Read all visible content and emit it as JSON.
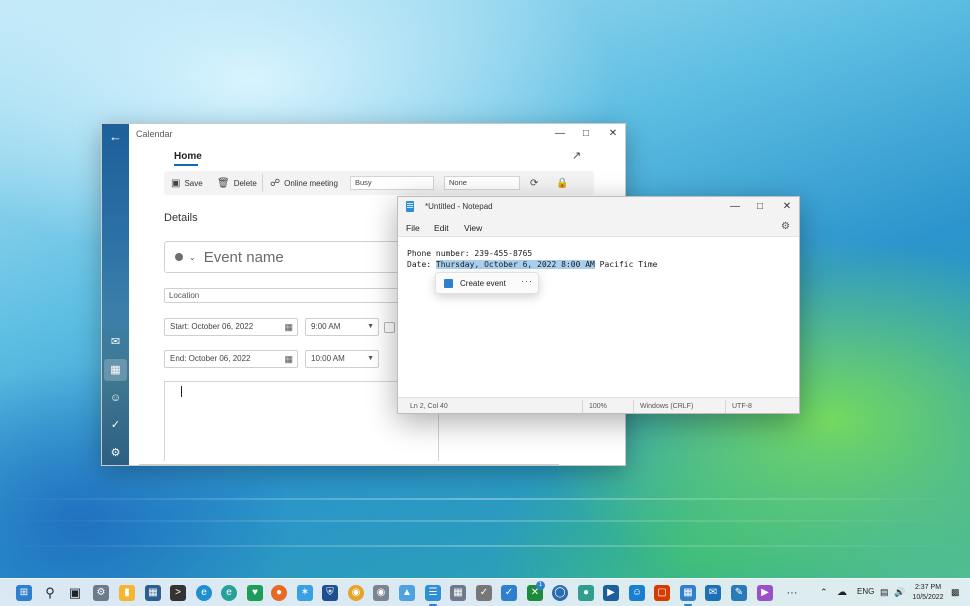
{
  "colors": {
    "accent": "#0f6cbd",
    "selection": "#a9cfee",
    "taskbar": "#e8f0f6"
  },
  "calendar": {
    "window_title": "Calendar",
    "tab_home": "Home",
    "toolbar": {
      "save": "Save",
      "delete": "Delete",
      "online_meeting": "Online meeting",
      "show_as": "Busy",
      "reminder": "None"
    },
    "details_heading": "Details",
    "event_name_placeholder": "Event name",
    "location_placeholder": "Location",
    "start_label": "Start: October 06, 2022",
    "start_time": "9:00 AM",
    "end_label": "End: October 06, 2022",
    "end_time": "10:00 AM",
    "nav_icons": [
      "back-arrow-icon",
      "mail-icon",
      "calendar-icon",
      "people-icon",
      "todo-icon",
      "settings-icon"
    ]
  },
  "notepad": {
    "window_title": "*Untitled - Notepad",
    "menu": [
      "File",
      "Edit",
      "View"
    ],
    "line1": "Phone number: 239-455-8765",
    "line2_prefix": "Date: ",
    "line2_selected": "Thursday, October 6, 2022 8:00 AM",
    "line2_suffix": " Pacific Time",
    "popup_label": "Create event",
    "popup_more": "···",
    "status": {
      "position": "Ln 2, Col 40",
      "zoom": "100%",
      "line_endings": "Windows (CRLF)",
      "encoding": "UTF-8"
    }
  },
  "taskbar": {
    "tray_lang": "ENG",
    "clock_time": "2:37 PM",
    "clock_date": "10/5/2022",
    "badge_count": "1"
  }
}
